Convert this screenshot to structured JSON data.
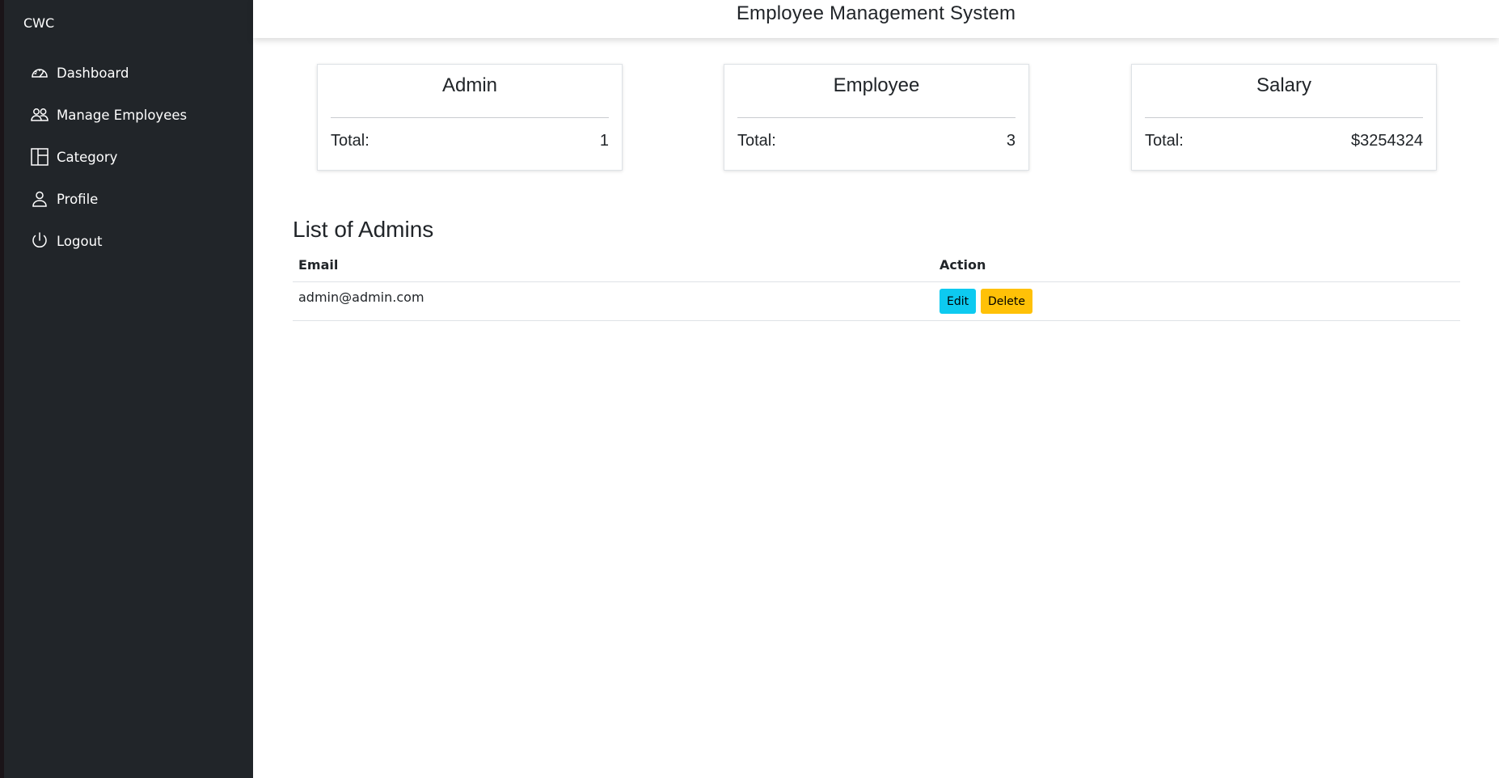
{
  "sidebar": {
    "brand": "CWC",
    "items": [
      {
        "label": "Dashboard",
        "icon": "speedometer-icon"
      },
      {
        "label": "Manage Employees",
        "icon": "people-icon"
      },
      {
        "label": "Category",
        "icon": "columns-icon"
      },
      {
        "label": "Profile",
        "icon": "person-icon"
      },
      {
        "label": "Logout",
        "icon": "power-icon"
      }
    ]
  },
  "header": {
    "title": "Employee Management System"
  },
  "cards": [
    {
      "title": "Admin",
      "total_label": "Total:",
      "total_value": "1"
    },
    {
      "title": "Employee",
      "total_label": "Total:",
      "total_value": "3"
    },
    {
      "title": "Salary",
      "total_label": "Total:",
      "total_value": "$3254324"
    }
  ],
  "admins_section": {
    "title": "List of Admins",
    "columns": [
      "Email",
      "Action"
    ],
    "rows": [
      {
        "email": "admin@admin.com",
        "edit_label": "Edit",
        "delete_label": "Delete"
      }
    ]
  },
  "colors": {
    "sidebar_bg": "#212529",
    "edit_button": "#0dcaf0",
    "delete_button": "#ffc107"
  }
}
